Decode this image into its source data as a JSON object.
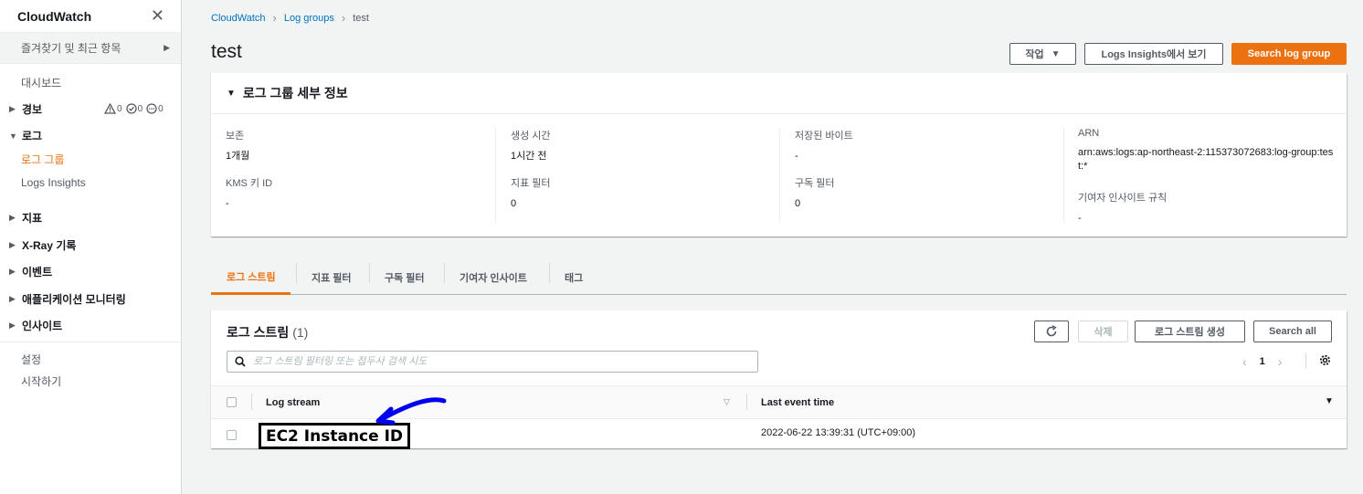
{
  "sidebar": {
    "title": "CloudWatch",
    "favorites": "즐겨찾기 및 최근 항목",
    "dashboard": "대시보드",
    "alarms": {
      "label": "경보",
      "alarm": "0",
      "ok": "0",
      "insufficient": "0"
    },
    "logs": {
      "label": "로그",
      "log_groups": "로그 그룹",
      "logs_insights": "Logs Insights"
    },
    "metrics": "지표",
    "xray": "X-Ray 기록",
    "events": "이벤트",
    "app_monitoring": "애플리케이션 모니터링",
    "insights": "인사이트",
    "settings": "설정",
    "getting_started": "시작하기"
  },
  "breadcrumb": {
    "cloudwatch": "CloudWatch",
    "log_groups": "Log groups",
    "current": "test"
  },
  "page": {
    "title": "test"
  },
  "actions": {
    "action": "작업",
    "view_insights": "Logs Insights에서 보기",
    "search": "Search log group"
  },
  "details": {
    "title": "로그 그룹 세부 정보",
    "retention": {
      "label": "보존",
      "value": "1개월"
    },
    "kms": {
      "label": "KMS 키 ID",
      "value": "-"
    },
    "created": {
      "label": "생성 시간",
      "value": "1시간 전"
    },
    "metric_filters": {
      "label": "지표 필터",
      "value": "0"
    },
    "stored_bytes": {
      "label": "저장된 바이트",
      "value": "-"
    },
    "subscription_filters": {
      "label": "구독 필터",
      "value": "0"
    },
    "arn": {
      "label": "ARN",
      "value": "arn:aws:logs:ap-northeast-2:115373072683:log-group:test:*"
    },
    "contributor_rules": {
      "label": "기여자 인사이트 규칙",
      "value": "-"
    }
  },
  "tabs": [
    "로그 스트림",
    "지표 필터",
    "구독 필터",
    "기여자 인사이트",
    "태그"
  ],
  "log_streams": {
    "title": "로그 스트림",
    "count": "(1)",
    "delete": "삭제",
    "create": "로그 스트림 생성",
    "search_all": "Search all",
    "search_placeholder": "로그 스트림 필터링 또는 접두사 검색 시도",
    "page": "1",
    "columns": {
      "stream": "Log stream",
      "last_event": "Last event time"
    },
    "rows": [
      {
        "stream": "EC2 Instance ID",
        "last_event": "2022-06-22 13:39:31 (UTC+09:00)"
      }
    ]
  },
  "colors": {
    "accent": "#ec7211",
    "link": "#0073bb",
    "annotation": "#0000ee"
  }
}
